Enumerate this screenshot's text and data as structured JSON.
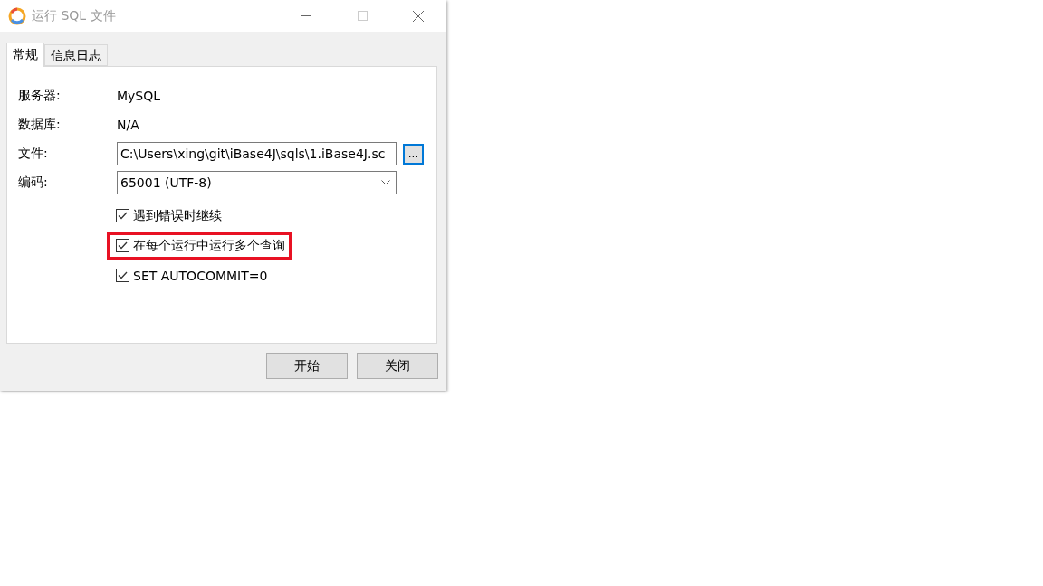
{
  "window": {
    "title": "运行 SQL 文件"
  },
  "tabs": [
    {
      "label": "常规",
      "selected": true
    },
    {
      "label": "信息日志",
      "selected": false
    }
  ],
  "info": [
    {
      "label": "服务器:",
      "value": "MySQL"
    },
    {
      "label": "数据库:",
      "value": "N/A"
    }
  ],
  "file": {
    "label": "文件:",
    "value": "C:\\Users\\xing\\git\\iBase4J\\sqls\\1.iBase4J.sc",
    "browse": "..."
  },
  "encoding": {
    "label": "编码:",
    "value": "65001 (UTF-8)"
  },
  "options": [
    {
      "label": "遇到错误时继续",
      "checked": true,
      "highlighted": false
    },
    {
      "label": "在每个运行中运行多个查询",
      "checked": true,
      "highlighted": true
    },
    {
      "label": "SET AUTOCOMMIT=0",
      "checked": true,
      "highlighted": false
    }
  ],
  "buttons": [
    "开始",
    "关闭"
  ]
}
